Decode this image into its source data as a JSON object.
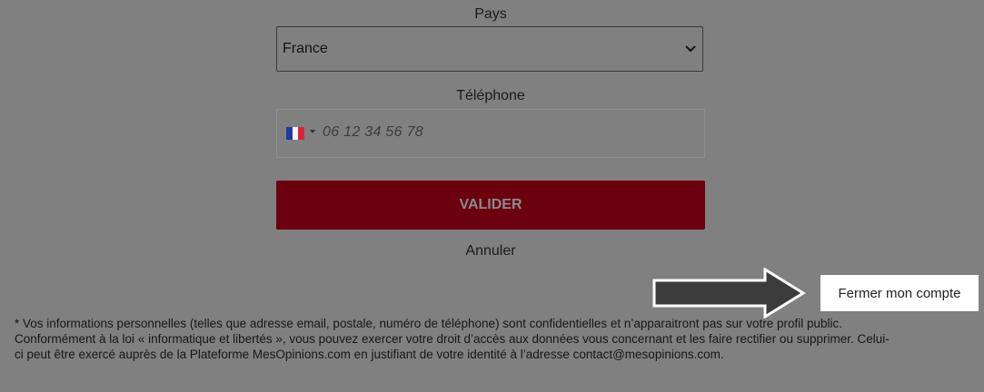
{
  "form": {
    "country_label": "Pays",
    "country_value": "France",
    "phone_label": "Téléphone",
    "phone_placeholder": "06 12 34 56 78",
    "phone_flag": "france-flag-icon",
    "submit_label": "VALIDER",
    "cancel_label": "Annuler"
  },
  "close_account": {
    "label": "Fermer mon compte"
  },
  "disclaimer": {
    "lines": [
      "* Vos informations personnelles (telles que adresse email, postale, numéro de téléphone) sont confidentielles et n’apparaitront pas sur votre profil public.",
      "Conformément à la loi « informatique et libertés », vous pouvez exercer votre droit d’accès aux données vous concernant et les faire rectifier ou supprimer. Celui-",
      "ci peut être exercé auprès de la Plateforme MesOpinions.com en justifiant de votre identité à l’adresse contact@mesopinions.com."
    ]
  },
  "colors": {
    "overlay_background": "#808080",
    "submit_background": "#6b000f",
    "highlight_background": "#ffffff",
    "arrow_fill": "#3c3c3c"
  }
}
